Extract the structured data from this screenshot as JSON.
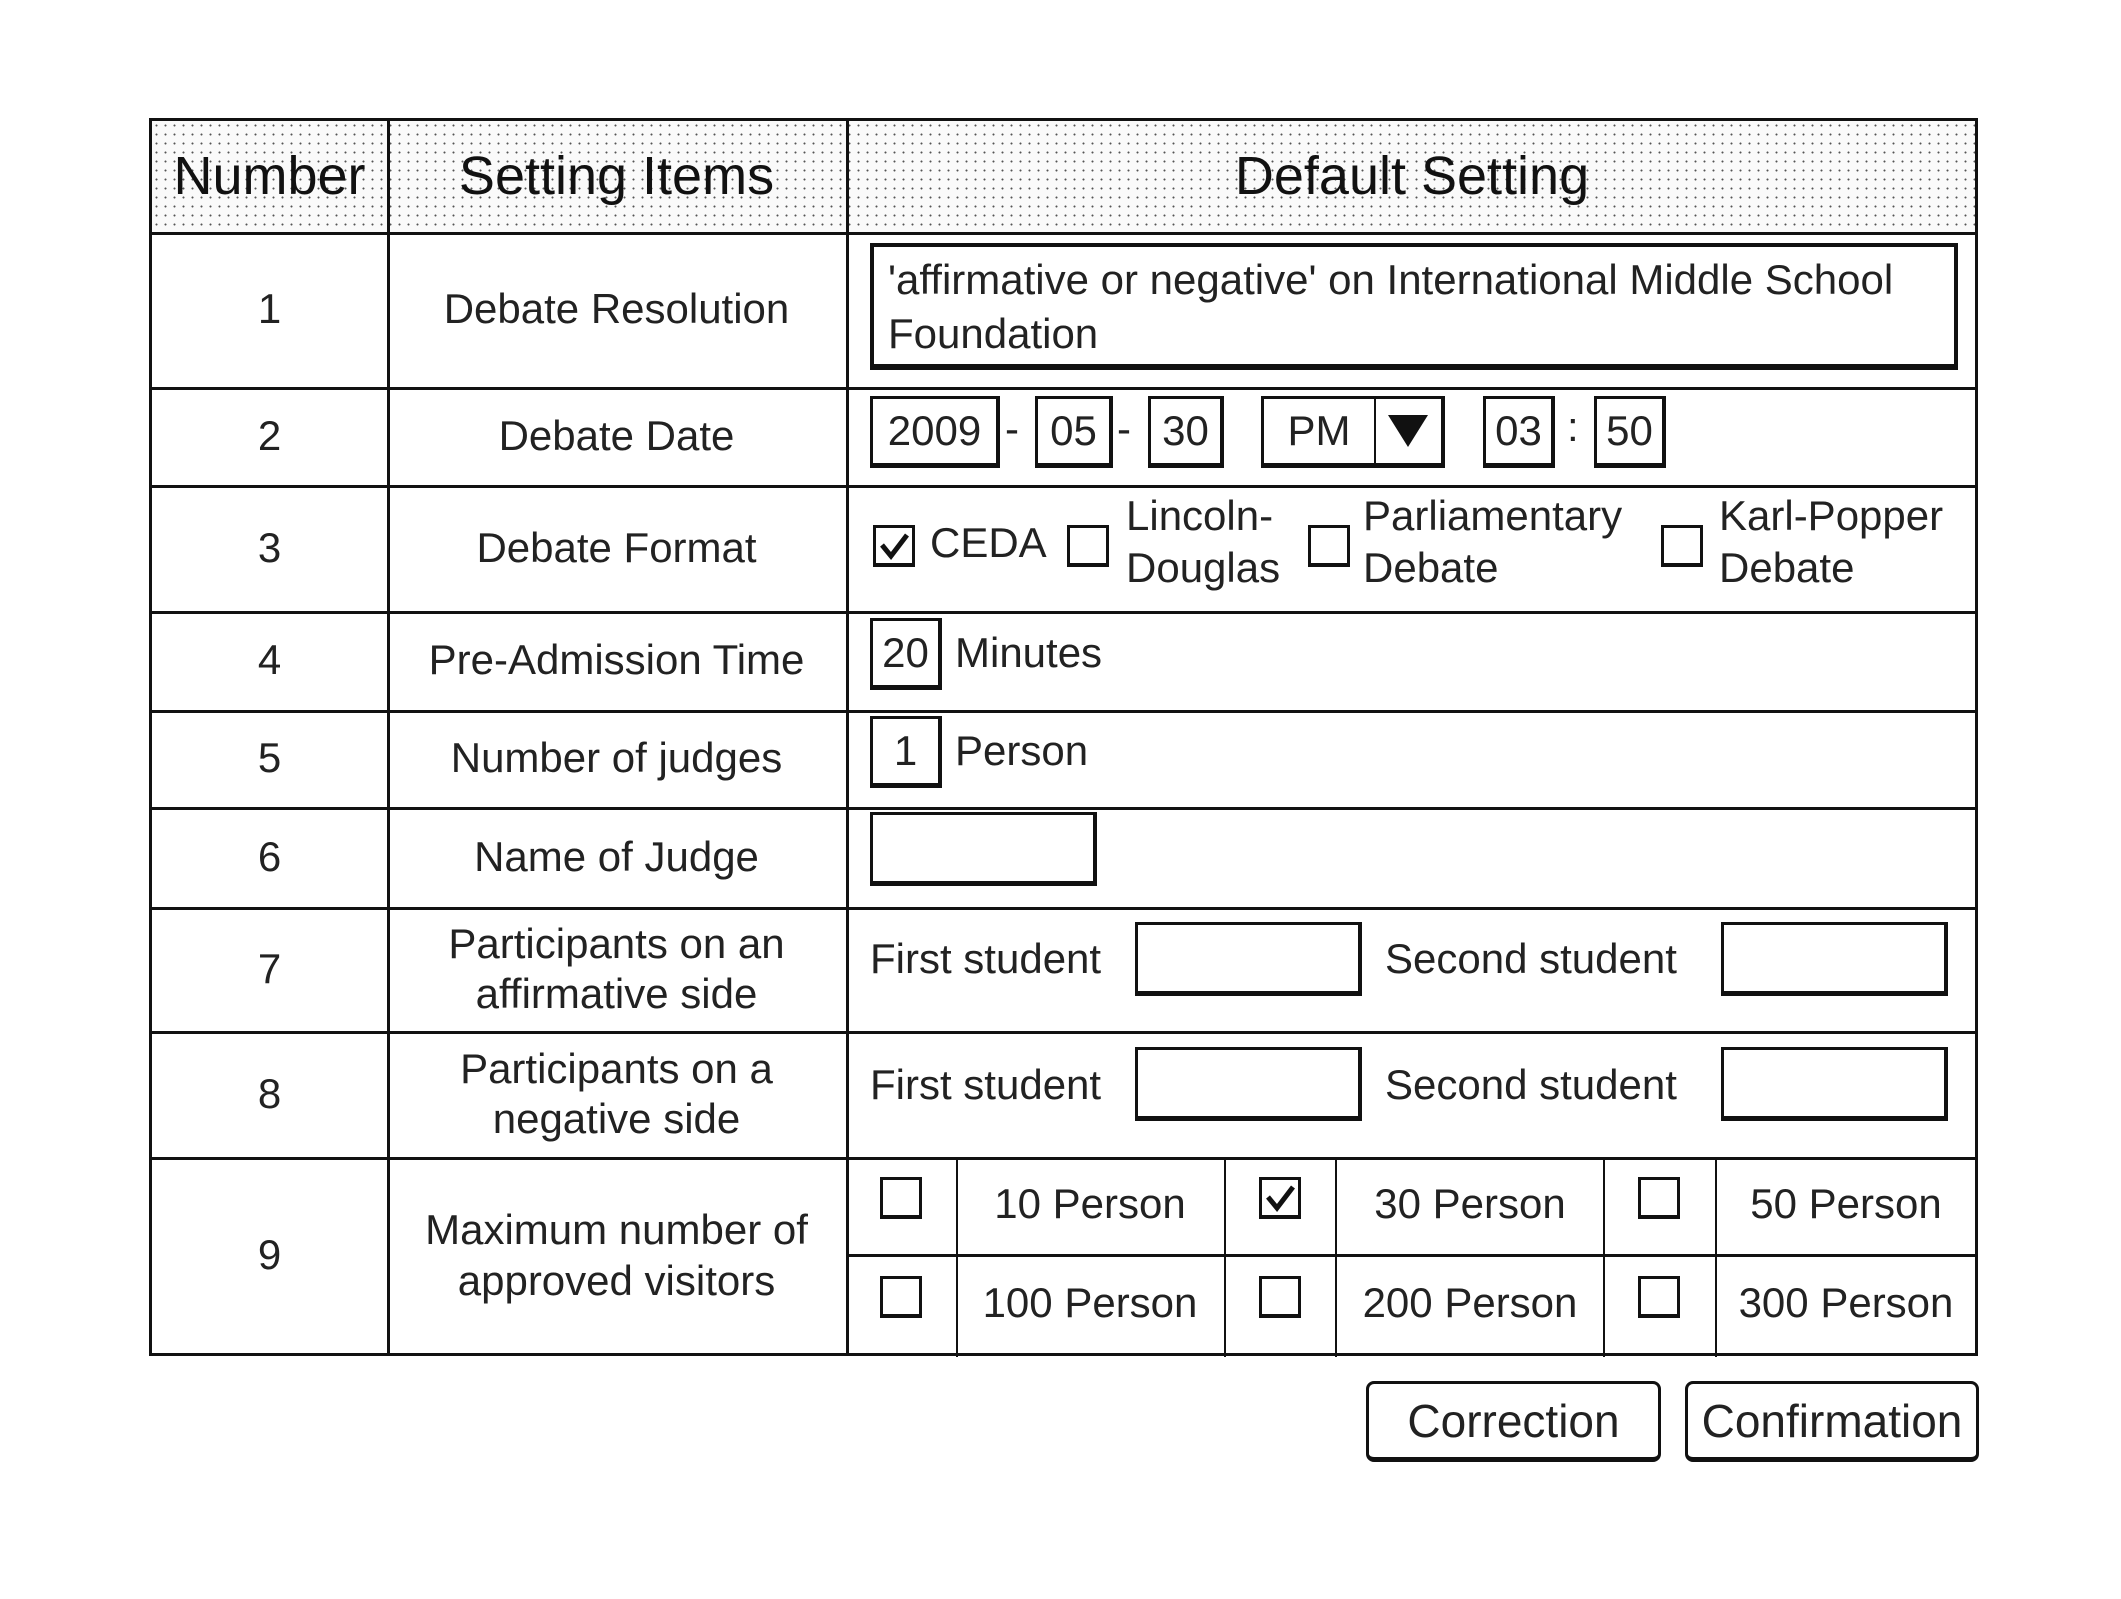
{
  "header": {
    "col_number": "Number",
    "col_items": "Setting Items",
    "col_default": "Default Setting"
  },
  "rows": [
    {
      "number": "1",
      "label": "Debate Resolution",
      "resolution_text": "'affirmative or negative' on International Middle School Foundation"
    },
    {
      "number": "2",
      "label": "Debate Date",
      "year": "2009",
      "month": "05",
      "day": "30",
      "sep_dash": "-",
      "ampm": "PM",
      "hour": "03",
      "minute": "50",
      "sep_colon": ":"
    },
    {
      "number": "3",
      "label": "Debate Format",
      "options": [
        {
          "label": "CEDA",
          "checked": true
        },
        {
          "label": "Lincoln-Douglas",
          "line1": "Lincoln-",
          "line2": "Douglas",
          "checked": false
        },
        {
          "label": "Parliamentary Debate",
          "line1": "Parliamentary",
          "line2": "Debate",
          "checked": false
        },
        {
          "label": "Karl-Popper Debate",
          "line1": "Karl-Popper",
          "line2": "Debate",
          "checked": false
        }
      ]
    },
    {
      "number": "4",
      "label": "Pre-Admission Time",
      "value": "20",
      "unit": "Minutes"
    },
    {
      "number": "5",
      "label": "Number of judges",
      "value": "1",
      "unit": "Person"
    },
    {
      "number": "6",
      "label": "Name of Judge",
      "value": ""
    },
    {
      "number": "7",
      "label_line1": "Participants on an",
      "label_line2": "affirmative side",
      "first_label": "First student",
      "first_value": "",
      "second_label": "Second student",
      "second_value": ""
    },
    {
      "number": "8",
      "label_line1": "Participants on a",
      "label_line2": "negative side",
      "first_label": "First student",
      "first_value": "",
      "second_label": "Second student",
      "second_value": ""
    },
    {
      "number": "9",
      "label_line1": "Maximum number of",
      "label_line2": "approved visitors",
      "options": [
        {
          "label": "10 Person",
          "checked": false
        },
        {
          "label": "30 Person",
          "checked": true
        },
        {
          "label": "50 Person",
          "checked": false
        },
        {
          "label": "100 Person",
          "checked": false
        },
        {
          "label": "200 Person",
          "checked": false
        },
        {
          "label": "300 Person",
          "checked": false
        }
      ]
    }
  ],
  "buttons": {
    "correction": "Correction",
    "confirmation": "Confirmation"
  },
  "icons": {
    "dropdown": "triangle-down",
    "check": "checkmark"
  }
}
